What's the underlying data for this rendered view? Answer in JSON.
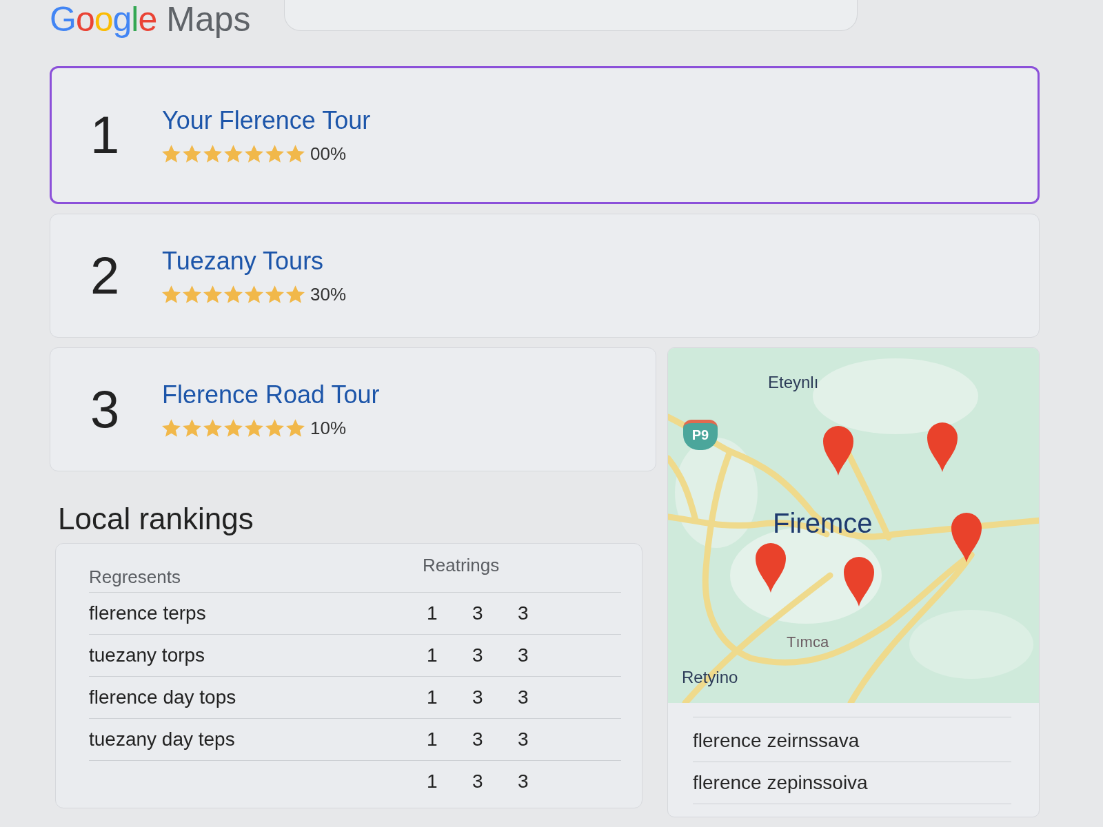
{
  "header": {
    "logo": {
      "brand": "Google",
      "product": "Maps"
    }
  },
  "results": [
    {
      "rank": "1",
      "title": "Your Flerence Tour",
      "stars": 7,
      "rating": "00%",
      "selected": true
    },
    {
      "rank": "2",
      "title": "Tuezany Tours",
      "stars": 7,
      "rating": "30%",
      "selected": false
    },
    {
      "rank": "3",
      "title": "Flerence Road Tour",
      "stars": 7,
      "rating": "10%",
      "selected": false
    }
  ],
  "local_rankings": {
    "title": "Local rankings",
    "columns": [
      "Regresents",
      "Reatrings"
    ],
    "rows": [
      {
        "name": "flerence terps",
        "values": [
          "1",
          "3",
          "3"
        ]
      },
      {
        "name": "tuezany torps",
        "values": [
          "1",
          "3",
          "3"
        ]
      },
      {
        "name": "flerence day tops",
        "values": [
          "1",
          "3",
          "3"
        ]
      },
      {
        "name": "tuezany day teps",
        "values": [
          "1",
          "3",
          "3"
        ]
      },
      {
        "values": [
          "1",
          "3",
          "3"
        ]
      }
    ]
  },
  "map": {
    "shield": "P9",
    "labels": [
      {
        "text": "Eteynlı",
        "kind": "place"
      },
      {
        "text": "Firemce",
        "kind": "city"
      },
      {
        "text": "Tımca",
        "kind": "area"
      },
      {
        "text": "Retyino",
        "kind": "place"
      }
    ]
  },
  "suggestions": [
    "flerence zeirnssava",
    "flerence zepinssoiva"
  ]
}
